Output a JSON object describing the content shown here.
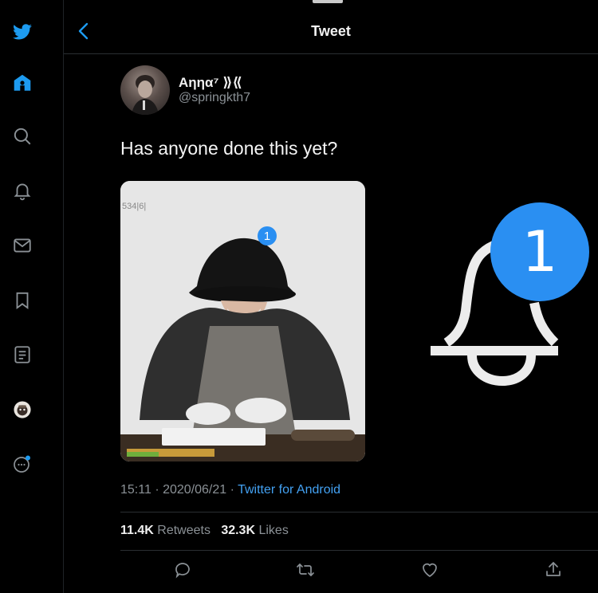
{
  "header": {
    "title": "Tweet"
  },
  "tweet": {
    "display_name": "Aηηα⁷ ⟫⟪",
    "handle": "@springkth7",
    "text": "Has anyone done this yet?",
    "time": "15:11",
    "date": "2020/06/21",
    "source": "Twitter for Android",
    "separator": "·"
  },
  "media": {
    "corner_tag": "534|6|",
    "badge_count": "1"
  },
  "overlay": {
    "badge_count": "1"
  },
  "stats": {
    "retweets_count": "11.4K",
    "retweets_label": "Retweets",
    "likes_count": "32.3K",
    "likes_label": "Likes"
  },
  "colors": {
    "accent": "#1d9bf0",
    "link": "#43a1f2",
    "badge": "#2a8ff2",
    "background": "#000000"
  },
  "icons": {
    "sidebar": [
      "twitter-logo-icon",
      "home-icon",
      "search-icon",
      "notifications-bell-icon",
      "messages-envelope-icon",
      "bookmarks-icon",
      "lists-icon",
      "profile-avatar",
      "more-icon"
    ],
    "actions": [
      "reply-icon",
      "retweet-icon",
      "like-heart-icon",
      "share-icon"
    ]
  }
}
